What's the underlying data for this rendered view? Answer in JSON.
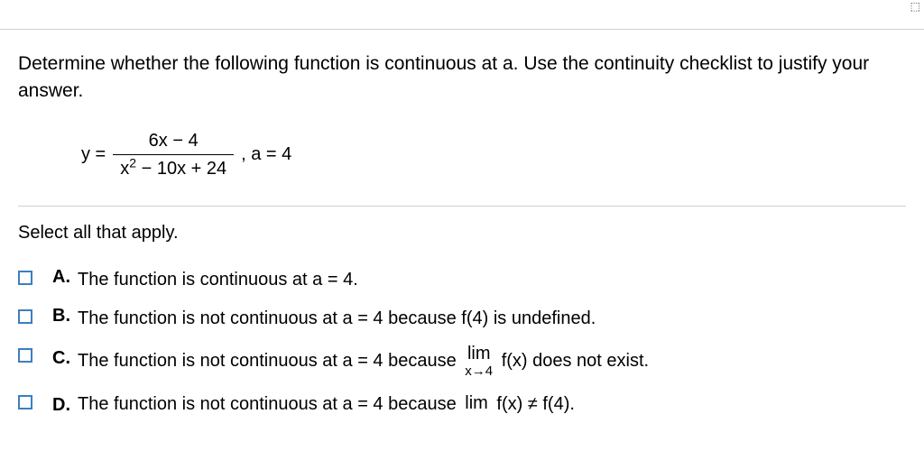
{
  "prompt": "Determine whether the following function is continuous at a. Use the continuity checklist to justify your answer.",
  "equation": {
    "lhs": "y =",
    "numerator": "6x − 4",
    "denominator_x": "x",
    "denominator_exp": "2",
    "denominator_rest": " − 10x + 24",
    "after": ", a = 4"
  },
  "select_all": "Select all that apply.",
  "options": {
    "A": {
      "letter": "A.",
      "text": "The function is continuous at a = 4."
    },
    "B": {
      "letter": "B.",
      "text": "The function is not continuous at a = 4 because f(4) is undefined."
    },
    "C": {
      "letter": "C.",
      "before": "The function is not continuous at a = 4 because ",
      "lim_top": "lim",
      "lim_bottom": "x→4",
      "after": " f(x) does not exist."
    },
    "D": {
      "letter": "D.",
      "before": "The function is not continuous at a = 4 because ",
      "lim_top": "lim",
      "lim_bottom": "",
      "after": " f(x) ≠ f(4)."
    }
  }
}
